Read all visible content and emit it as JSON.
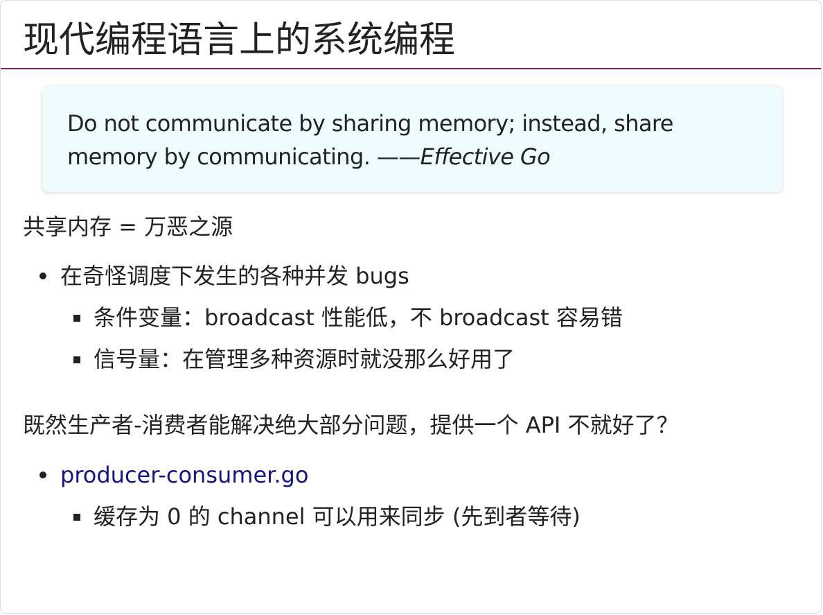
{
  "slide": {
    "title": "现代编程语言上的系统编程",
    "quote": {
      "text": "Do not communicate by sharing memory; instead, share memory by communicating. ——",
      "source": "Effective Go"
    },
    "section1": {
      "heading": "共享内存 = 万恶之源",
      "bullet": "在奇怪调度下发生的各种并发 bugs",
      "subbullets": [
        "条件变量：broadcast 性能低，不 broadcast 容易错",
        "信号量：在管理多种资源时就没那么好用了"
      ]
    },
    "section2": {
      "heading": "既然生产者-消费者能解决绝大部分问题，提供一个 API 不就好了？",
      "link_text": "producer-consumer.go",
      "subbullets": [
        "缓存为 0 的 channel 可以用来同步 (先到者等待)"
      ]
    }
  },
  "colors": {
    "accent_rule": "#7a1f6a",
    "quote_background": "#effcfd",
    "link": "#121488"
  }
}
